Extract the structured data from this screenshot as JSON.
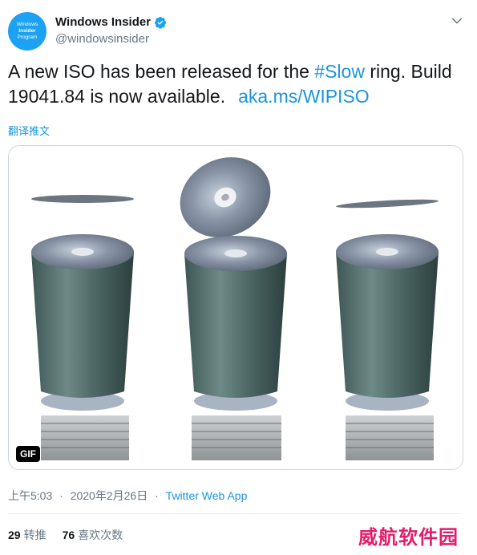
{
  "account": {
    "avatar_lines": [
      "Windows",
      "Insider",
      "Program"
    ],
    "display_name": "Windows Insider",
    "handle": "@windowsinsider"
  },
  "tweet": {
    "text_part1": "A new ISO has been released for the ",
    "hashtag": "#Slow",
    "text_part2": " ring. Build 19041.84 is now available.",
    "link": "aka.ms/WIPISO",
    "translate": "翻译推文"
  },
  "media": {
    "badge": "GIF"
  },
  "meta": {
    "time": "上午5:03",
    "separator": "·",
    "date": "2020年2月26日",
    "source": "Twitter Web App"
  },
  "stats": {
    "retweets_count": "29",
    "retweets_label": "转推",
    "likes_count": "76",
    "likes_label": "喜欢次数"
  },
  "watermark": "威航软件园",
  "colors": {
    "accent": "#1b95e0",
    "avatar": "#1da1f2",
    "secondary_text": "#657786",
    "watermark": "#e51c6b"
  }
}
